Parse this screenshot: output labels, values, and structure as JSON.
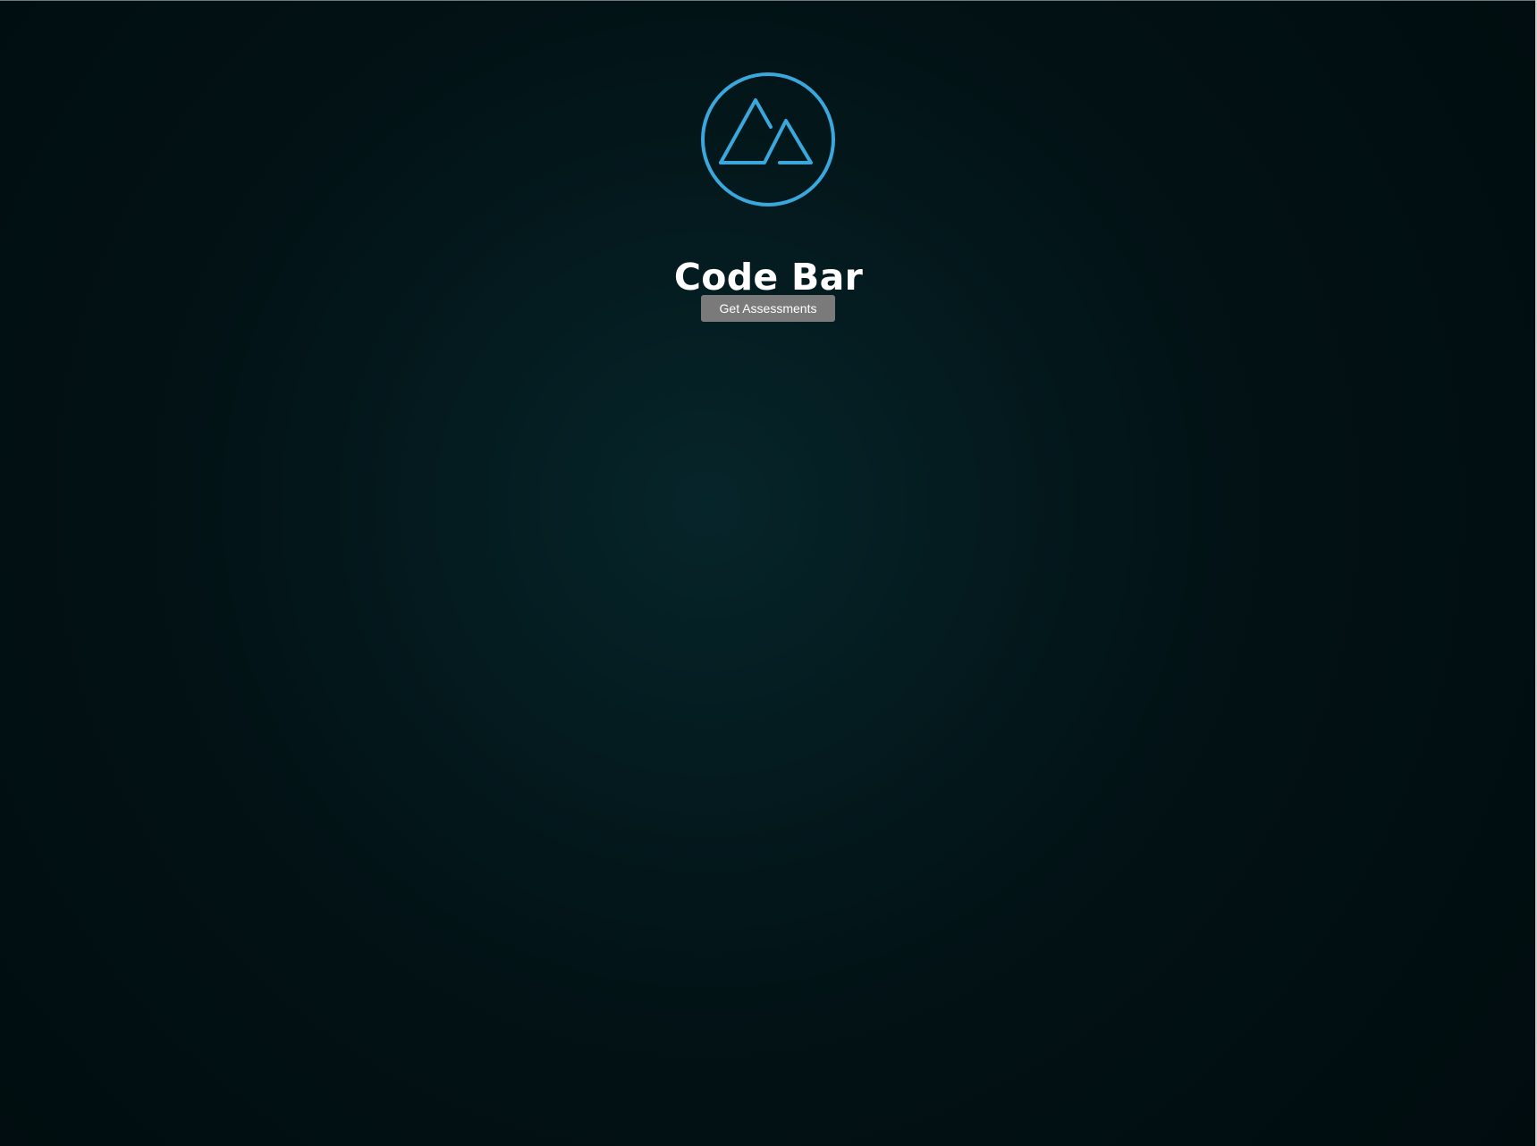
{
  "app": {
    "title": "Code Bar",
    "logo_icon": "mountain-circle-icon",
    "accent_color": "#3aa8dd",
    "background_color": "#021215"
  },
  "actions": {
    "get_assessments_label": "Get Assessments",
    "button_color": "#7a7a7a"
  }
}
